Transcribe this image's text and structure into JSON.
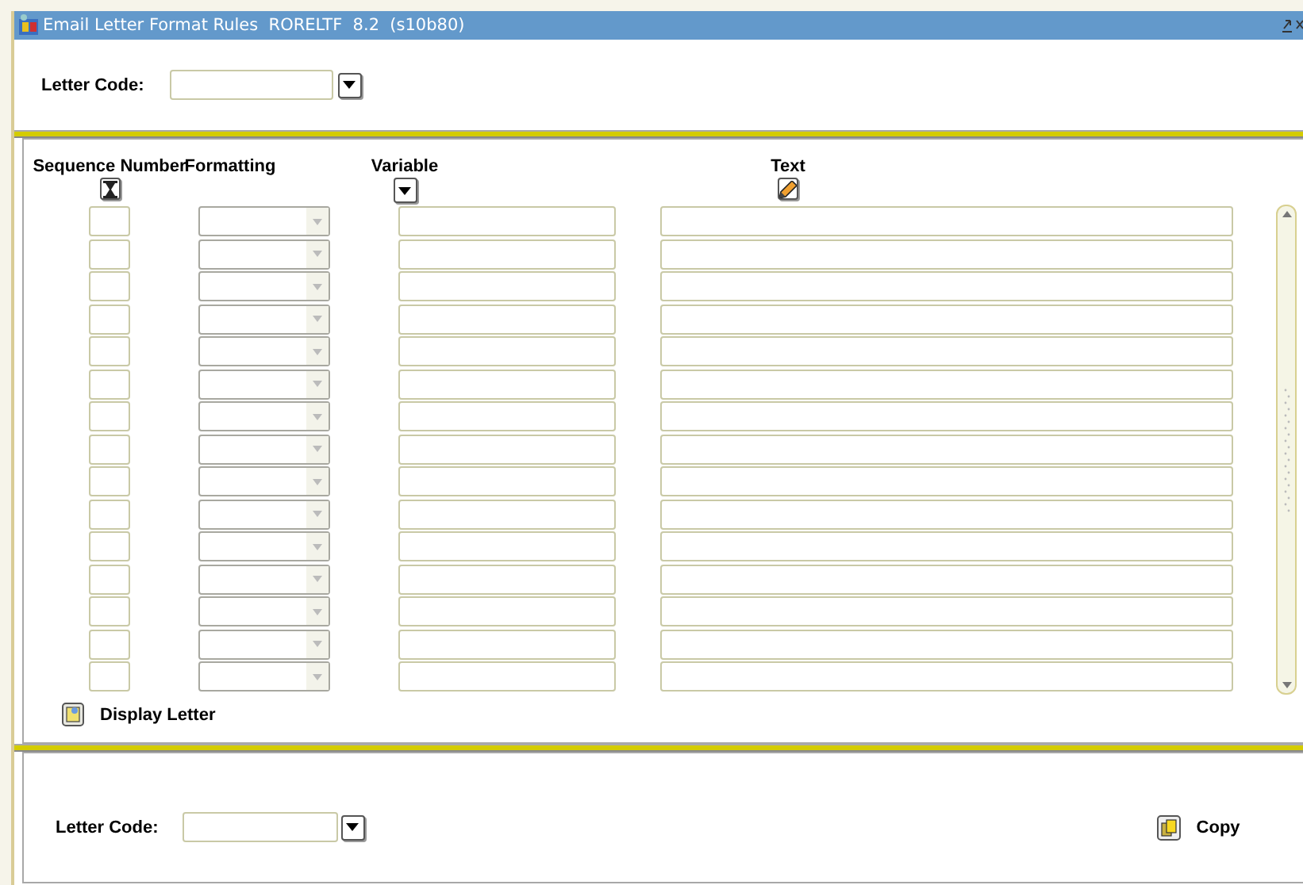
{
  "window": {
    "title": "Email Letter Format Rules  RORELTF  8.2  (s10b80)"
  },
  "key_block": {
    "label": "Letter Code:"
  },
  "columns": [
    {
      "label": "Sequence Number",
      "kind": "hourglass"
    },
    {
      "label": "Formatting",
      "kind": "none"
    },
    {
      "label": "Variable",
      "kind": "dropdown"
    },
    {
      "label": "Text",
      "kind": "pencil"
    }
  ],
  "rows": [
    {
      "kind": "empty"
    },
    {
      "kind": "empty"
    },
    {
      "kind": "empty"
    },
    {
      "kind": "empty"
    },
    {
      "kind": "empty"
    },
    {
      "kind": "empty"
    },
    {
      "kind": "empty"
    },
    {
      "kind": "empty"
    },
    {
      "kind": "empty"
    },
    {
      "kind": "empty"
    },
    {
      "kind": "empty"
    },
    {
      "kind": "empty"
    },
    {
      "kind": "empty"
    },
    {
      "kind": "empty"
    },
    {
      "kind": "empty"
    }
  ],
  "display_letter": {
    "label": "Display Letter"
  },
  "copy_block": {
    "label": "Letter Code:",
    "button": "Copy"
  }
}
